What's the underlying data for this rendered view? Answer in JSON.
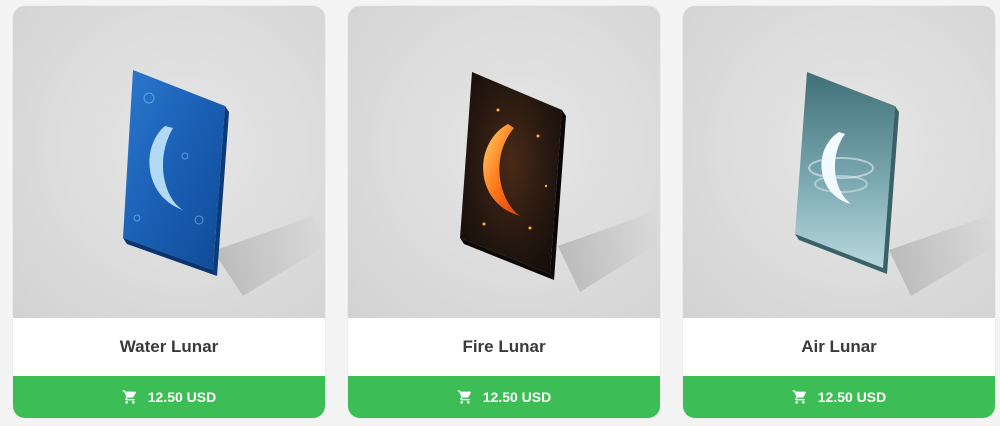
{
  "products": [
    {
      "name": "Water Lunar",
      "price": "12.50 USD",
      "theme": "water",
      "colors": {
        "main": "#1f63b8",
        "dark": "#0c3d7d",
        "moon": "#bfe6ff"
      }
    },
    {
      "name": "Fire Lunar",
      "price": "12.50 USD",
      "theme": "fire",
      "colors": {
        "main": "#1d1411",
        "dark": "#3c2416",
        "moon": "#ff8a1e"
      }
    },
    {
      "name": "Air Lunar",
      "price": "12.50 USD",
      "theme": "air",
      "colors": {
        "main": "#6e9ea6",
        "dark": "#3f6e76",
        "moon": "#f4fbff"
      }
    }
  ],
  "icons": {
    "cart": "shopping-cart-icon"
  },
  "accent": "#3dbd55"
}
